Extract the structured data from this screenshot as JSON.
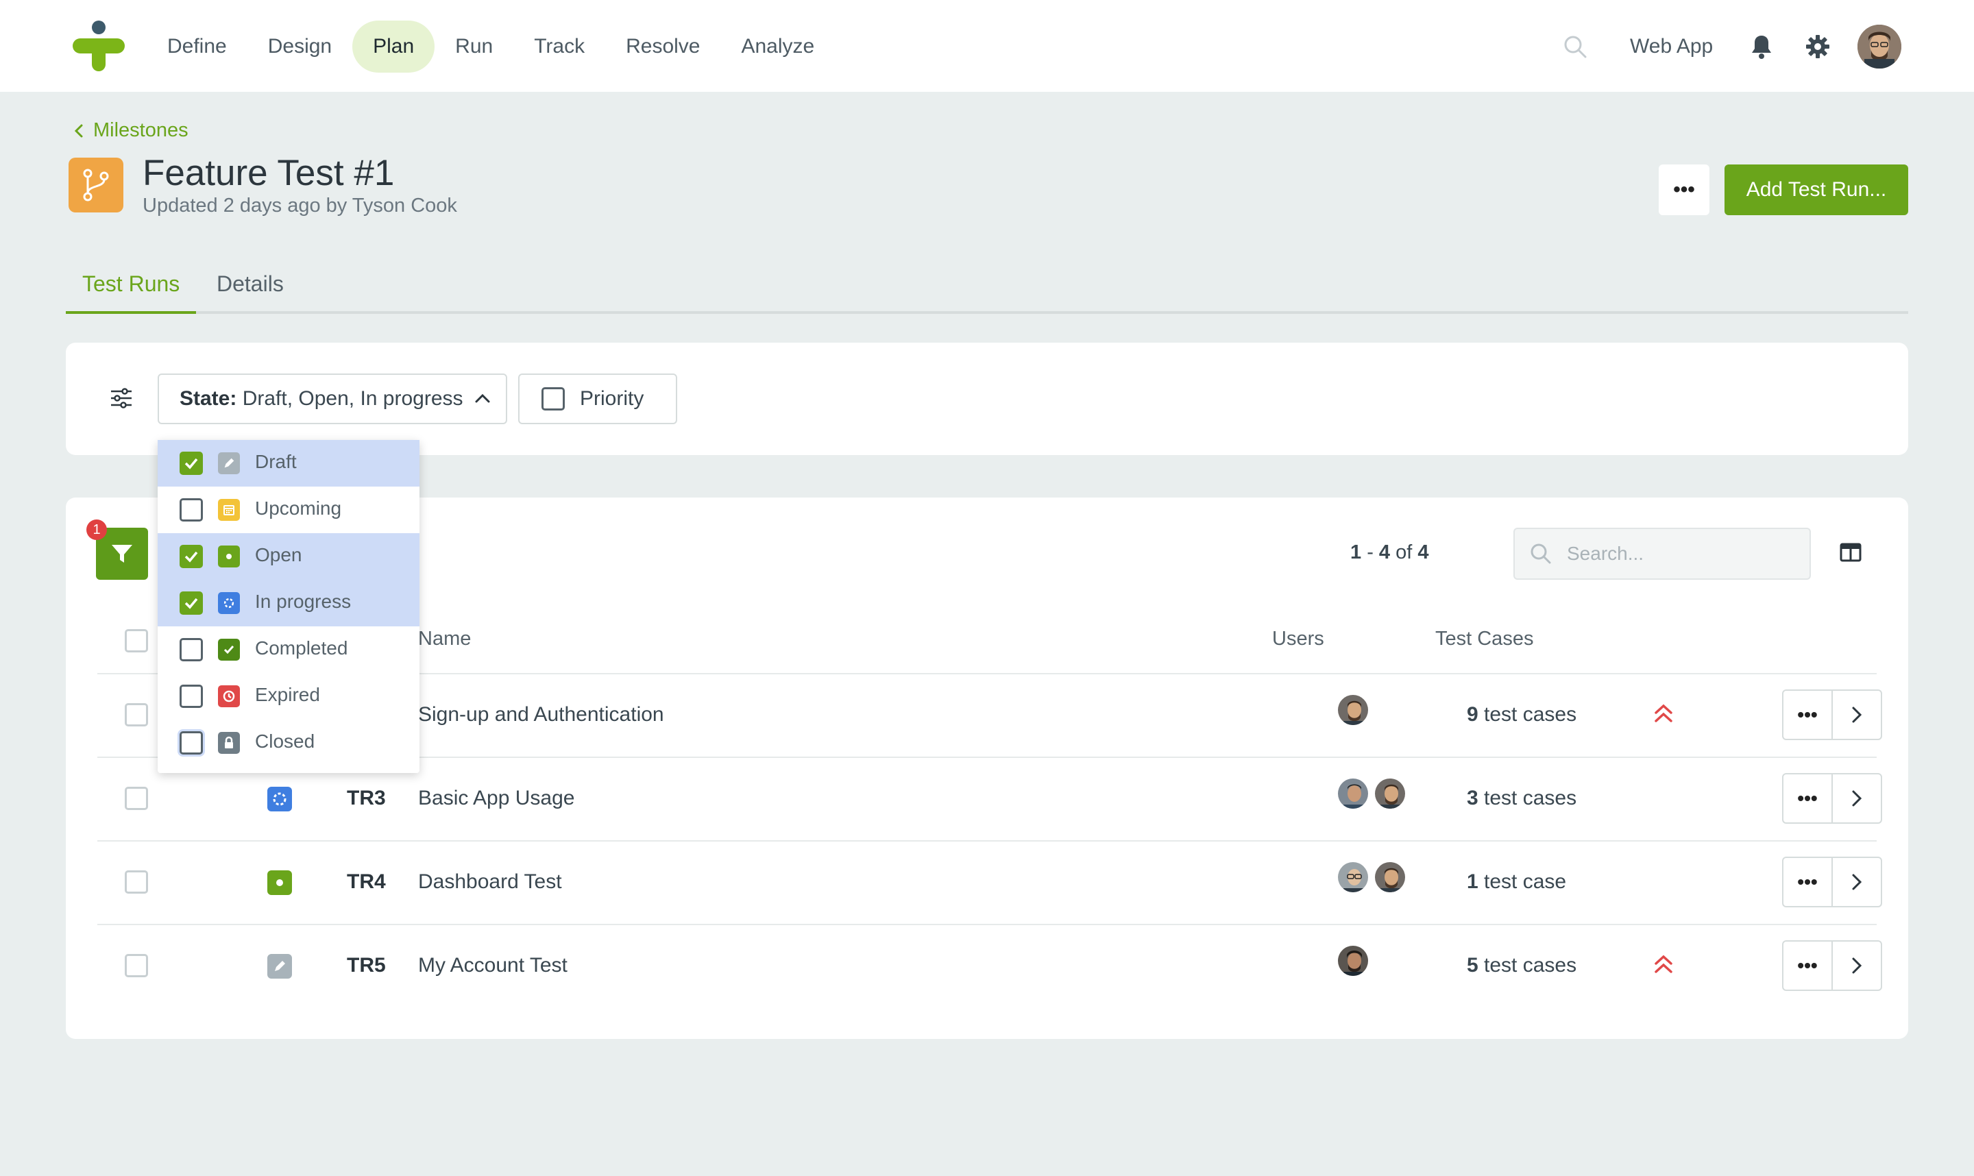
{
  "nav": {
    "items": [
      "Define",
      "Design",
      "Plan",
      "Run",
      "Track",
      "Resolve",
      "Analyze"
    ],
    "active": "Plan",
    "workspace": "Web App"
  },
  "page": {
    "breadcrumb": "Milestones",
    "title": "Feature Test #1",
    "subtitle": "Updated 2 days ago by Tyson Cook",
    "more_label": "•••",
    "add_button": "Add Test Run...",
    "tabs": [
      "Test Runs",
      "Details"
    ]
  },
  "filters": {
    "state_label": "State:",
    "state_value": "Draft, Open, In progress",
    "priority_label": "Priority"
  },
  "state_options": [
    {
      "label": "Draft",
      "checked": true,
      "color": "#a8b3ba"
    },
    {
      "label": "Upcoming",
      "checked": false,
      "color": "#f3c338"
    },
    {
      "label": "Open",
      "checked": true,
      "color": "#6aa51b"
    },
    {
      "label": "In progress",
      "checked": true,
      "color": "#3f7ee0"
    },
    {
      "label": "Completed",
      "checked": false,
      "color": "#4e8a16"
    },
    {
      "label": "Expired",
      "checked": false,
      "color": "#e04848"
    },
    {
      "label": "Closed",
      "checked": false,
      "color": "#6f7d86"
    }
  ],
  "table": {
    "filter_badge": "1",
    "range_a": "1",
    "range_sep": " - ",
    "range_b": "4",
    "range_of": " of ",
    "range_total": "4",
    "search_placeholder": "Search...",
    "headers": {
      "name": "Name",
      "users": "Users",
      "test_cases": "Test Cases"
    },
    "rows": [
      {
        "id": "",
        "name": "Sign-up and Authentication",
        "count": "9",
        "cases_label": " test cases",
        "priority_high": true,
        "state": "hidden"
      },
      {
        "id": "TR3",
        "name": "Basic App Usage",
        "count": "3",
        "cases_label": " test cases",
        "priority_high": false,
        "state": "In progress"
      },
      {
        "id": "TR4",
        "name": "Dashboard Test",
        "count": "1",
        "cases_label": " test case",
        "priority_high": false,
        "state": "Open"
      },
      {
        "id": "TR5",
        "name": "My Account Test",
        "count": "5",
        "cases_label": " test cases",
        "priority_high": true,
        "state": "Draft"
      }
    ],
    "row_more": "•••"
  },
  "colors": {
    "accent": "#6aa51b",
    "danger": "#e04848",
    "blue": "#3f7ee0",
    "orange": "#f0a544"
  }
}
